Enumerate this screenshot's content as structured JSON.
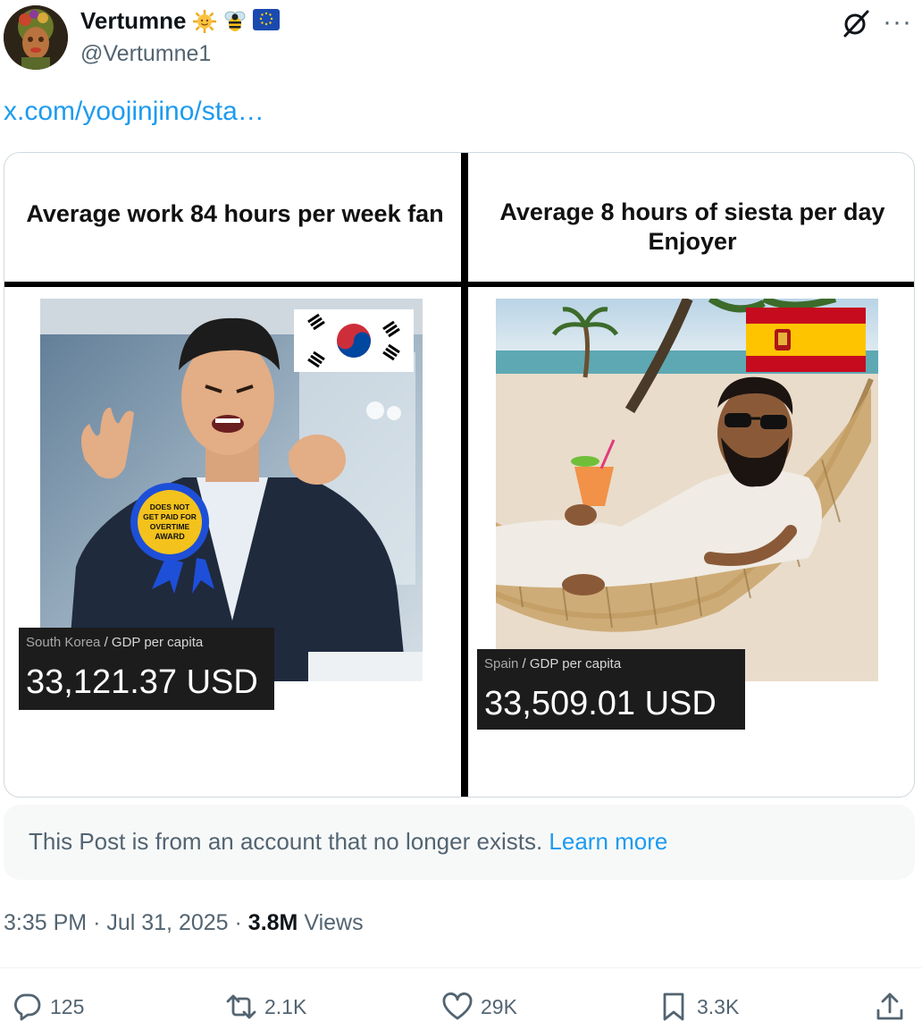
{
  "author": {
    "display_name": "Vertumne",
    "handle": "@Vertumne1",
    "badges": [
      "sun-emoji",
      "bee-emoji",
      "eu-flag-emoji"
    ]
  },
  "link_text": "x.com/yoojinjino/sta…",
  "meme": {
    "left_title": "Average work 84 hours per week fan",
    "right_title_line1": "Average 8 hours of siesta per day",
    "right_title_line2": "Enjoyer",
    "left_badge_lines": [
      "DOES NOT",
      "GET PAID FOR",
      "OVERTIME",
      "AWARD"
    ],
    "left_gdp": {
      "country": "South Korea",
      "separator": "/",
      "metric": "GDP per capita",
      "value": "33,121.37 USD"
    },
    "right_gdp": {
      "country": "Spain",
      "separator": "/",
      "metric": "GDP per capita",
      "value": "33,509.01 USD"
    }
  },
  "notice": {
    "text": "This Post is from an account that no longer exists.",
    "link": "Learn more"
  },
  "meta": {
    "time": "3:35 PM",
    "dot": "·",
    "date": "Jul 31, 2025",
    "views_count": "3.8M",
    "views_label": "Views"
  },
  "actions": {
    "replies": "125",
    "reposts": "2.1K",
    "likes": "29K",
    "bookmarks": "3.3K"
  },
  "colors": {
    "link": "#1d9bf0",
    "secondary_text": "#536471",
    "primary_text": "#0f1419"
  }
}
